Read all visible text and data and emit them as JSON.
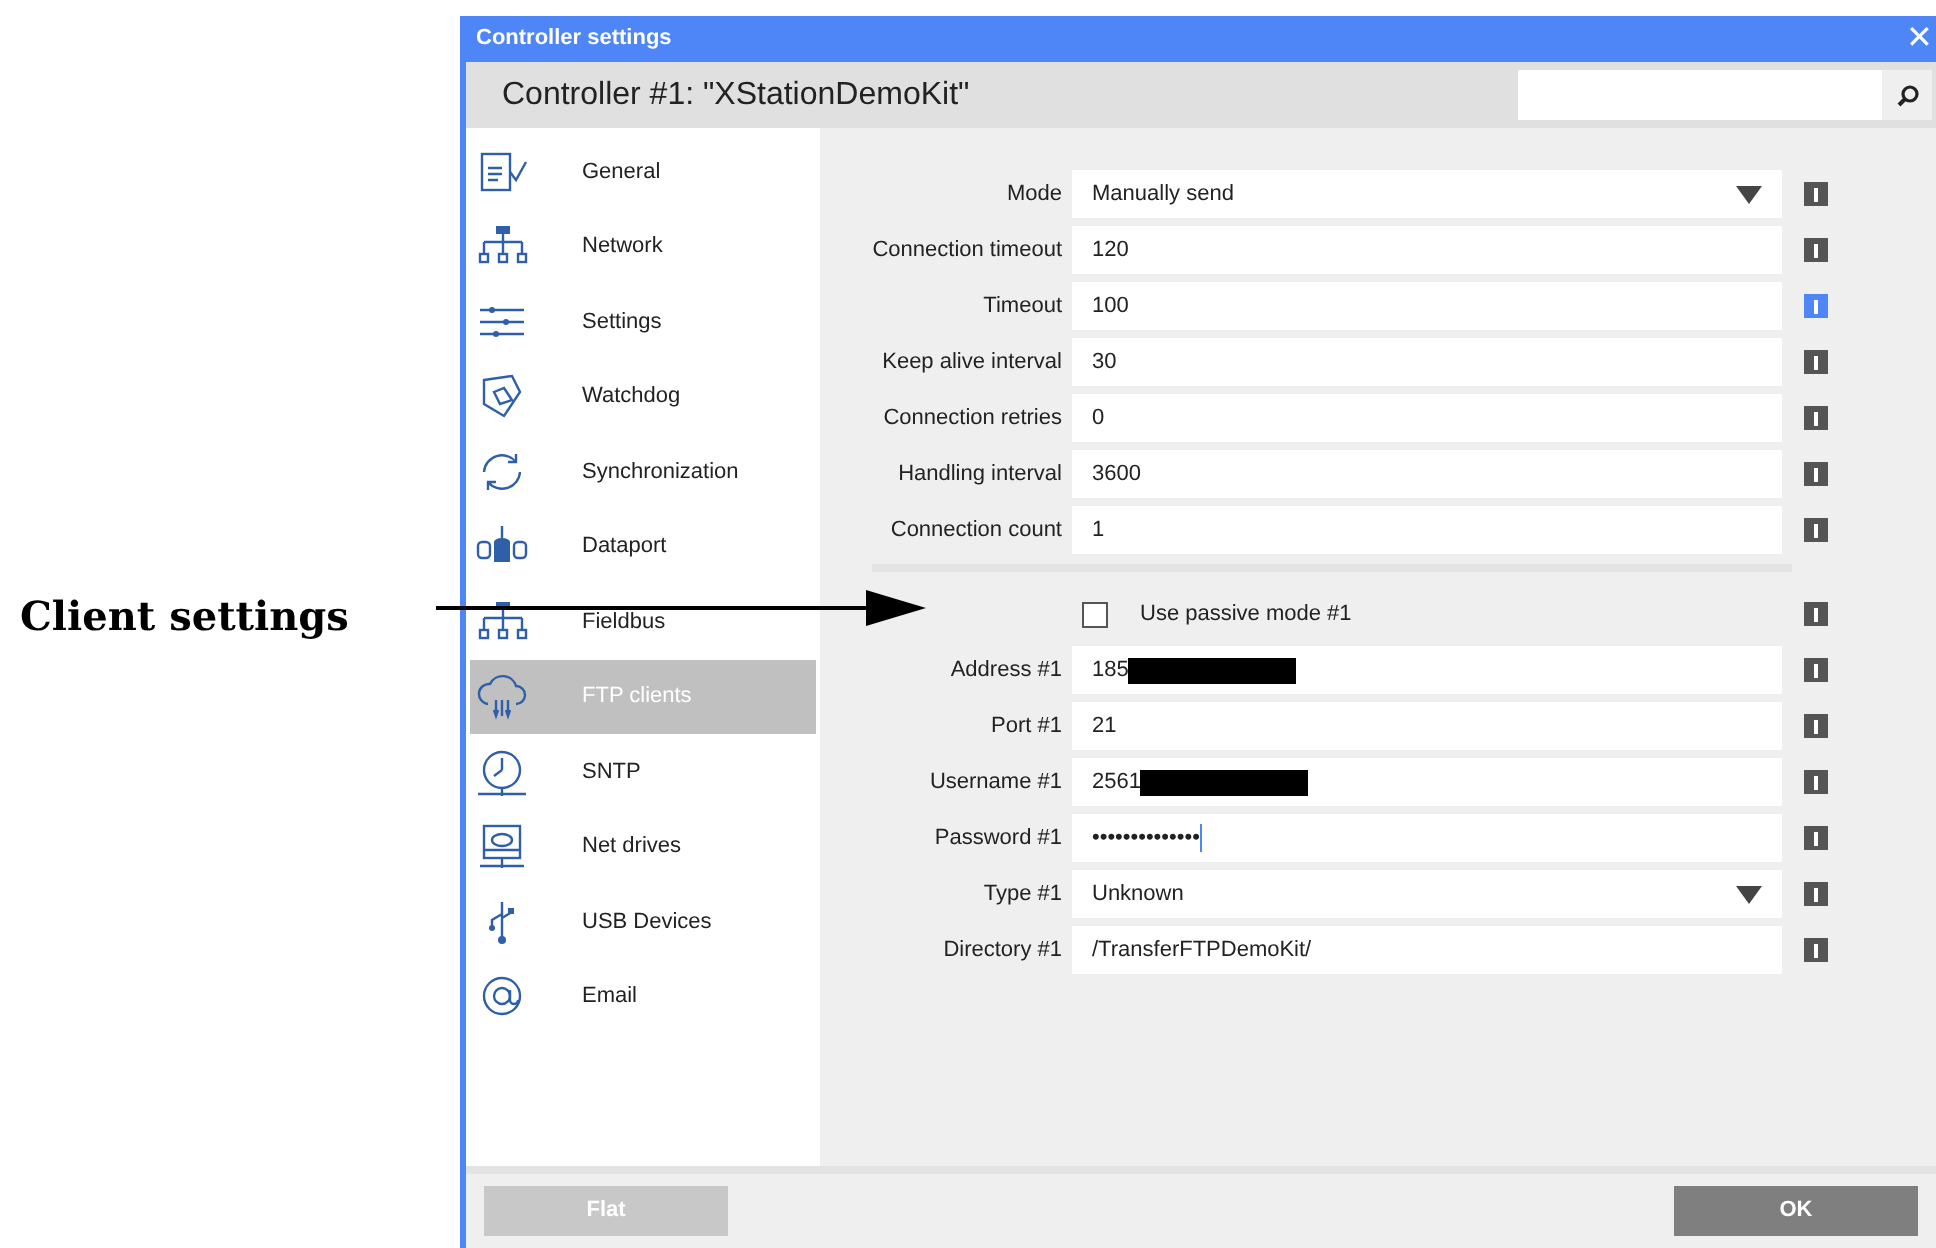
{
  "annotation": {
    "label": "Client settings"
  },
  "window": {
    "title": "Controller settings",
    "close": "✕"
  },
  "header": {
    "title": "Controller #1: \"XStationDemoKit\""
  },
  "sidebar": {
    "items": [
      {
        "label": "General",
        "selected": false
      },
      {
        "label": "Network",
        "selected": false
      },
      {
        "label": "Settings",
        "selected": false
      },
      {
        "label": "Watchdog",
        "selected": false
      },
      {
        "label": "Synchronization",
        "selected": false
      },
      {
        "label": "Dataport",
        "selected": false
      },
      {
        "label": "Fieldbus",
        "selected": false
      },
      {
        "label": "FTP clients",
        "selected": true
      },
      {
        "label": "SNTP",
        "selected": false
      },
      {
        "label": "Net drives",
        "selected": false
      },
      {
        "label": "USB Devices",
        "selected": false
      },
      {
        "label": "Email",
        "selected": false
      }
    ]
  },
  "fields": [
    {
      "kind": "select",
      "label": "Mode",
      "value": "Manually send",
      "info_highlighted": false
    },
    {
      "kind": "text",
      "label": "Connection timeout",
      "value": "120",
      "info_highlighted": false
    },
    {
      "kind": "text",
      "label": "Timeout",
      "value": "100",
      "info_highlighted": true
    },
    {
      "kind": "text",
      "label": "Keep alive interval",
      "value": "30",
      "info_highlighted": false
    },
    {
      "kind": "text",
      "label": "Connection retries",
      "value": "0",
      "info_highlighted": false
    },
    {
      "kind": "text",
      "label": "Handling interval",
      "value": "3600",
      "info_highlighted": false
    },
    {
      "kind": "text",
      "label": "Connection count",
      "value": "1",
      "info_highlighted": false
    },
    {
      "kind": "separator"
    },
    {
      "kind": "checkbox",
      "label": "Use passive mode #1",
      "checked": false,
      "info_highlighted": false
    },
    {
      "kind": "text",
      "label": "Address #1",
      "value": "185",
      "redacted": true,
      "info_highlighted": false
    },
    {
      "kind": "text",
      "label": "Port #1",
      "value": "21",
      "info_highlighted": false
    },
    {
      "kind": "text",
      "label": "Username #1",
      "value": "2561",
      "redacted": true,
      "info_highlighted": false
    },
    {
      "kind": "password",
      "label": "Password #1",
      "value": "••••••••••••••",
      "focused": true,
      "info_highlighted": false
    },
    {
      "kind": "select",
      "label": "Type #1",
      "value": "Unknown",
      "info_highlighted": false
    },
    {
      "kind": "text",
      "label": "Directory #1",
      "value": "/TransferFTPDemoKit/",
      "info_highlighted": false
    }
  ],
  "footer": {
    "buttons": [
      {
        "label": "Flat",
        "disabled": true
      },
      {
        "label": "OK",
        "disabled": false
      }
    ]
  }
}
